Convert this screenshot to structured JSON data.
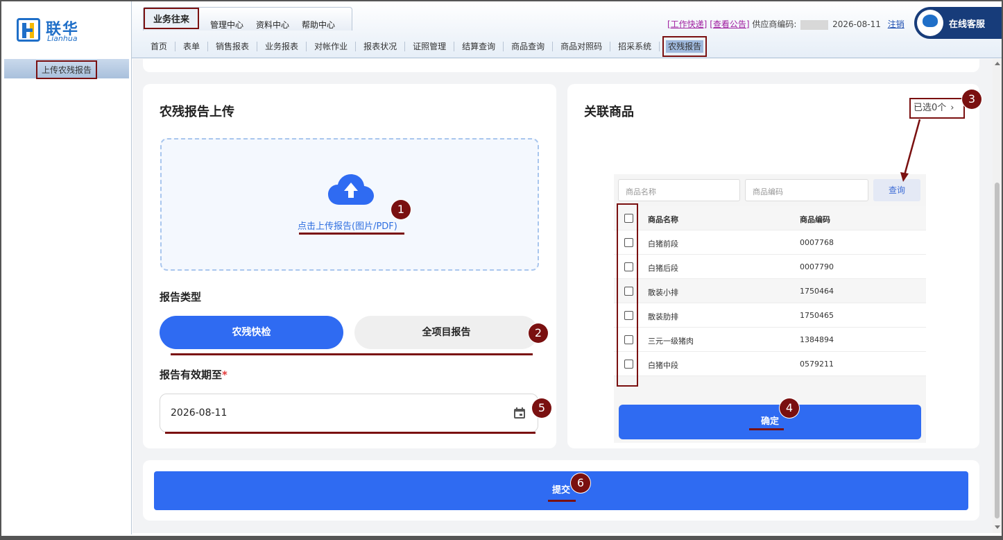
{
  "brand": {
    "name_cn": "联华",
    "name_en": "Lianhua"
  },
  "sidebar": {
    "items": [
      {
        "label": "上传农残报告"
      }
    ]
  },
  "header": {
    "top_tabs": [
      "业务往来",
      "管理中心",
      "资料中心",
      "帮助中心"
    ],
    "links": {
      "work_express": "[工作快递]",
      "announcements": "[查看公告]"
    },
    "supplier_code_label": "供应商编码:",
    "date": "2026-08-11",
    "logout": "注销",
    "customer_service": "在线客服",
    "nav": [
      "首页",
      "表单",
      "销售报表",
      "业务报表",
      "对帐作业",
      "报表状况",
      "证照管理",
      "结算查询",
      "商品查询",
      "商品对照码",
      "招采系统",
      "农残报告"
    ]
  },
  "upload_card": {
    "title": "农残报告上传",
    "upload_link": "点击上传报告(图片/PDF)",
    "report_type_label": "报告类型",
    "report_types": [
      "农残快检",
      "全项目报告"
    ],
    "valid_until_label": "报告有效期至",
    "required_mark": "*",
    "valid_until_value": "2026-08-11"
  },
  "goods_card": {
    "title": "关联商品",
    "selected": "已选0个",
    "name_placeholder": "商品名称",
    "code_placeholder": "商品编码",
    "query_button": "查询",
    "columns": [
      "商品名称",
      "商品编码"
    ],
    "rows": [
      {
        "name": "白猪前段",
        "code": "0007768"
      },
      {
        "name": "白猪后段",
        "code": "0007790"
      },
      {
        "name": "散装小排",
        "code": "1750464"
      },
      {
        "name": "散装肋排",
        "code": "1750465"
      },
      {
        "name": "三元一级猪肉",
        "code": "1384894"
      },
      {
        "name": "白猪中段",
        "code": "0579211"
      }
    ],
    "confirm_button": "确定"
  },
  "submit_button": "提交",
  "annotations": [
    "1",
    "2",
    "3",
    "4",
    "5",
    "6"
  ],
  "colors": {
    "primary": "#2f6bf2",
    "annotation": "#7a1010",
    "brand": "#1f6fc8"
  }
}
